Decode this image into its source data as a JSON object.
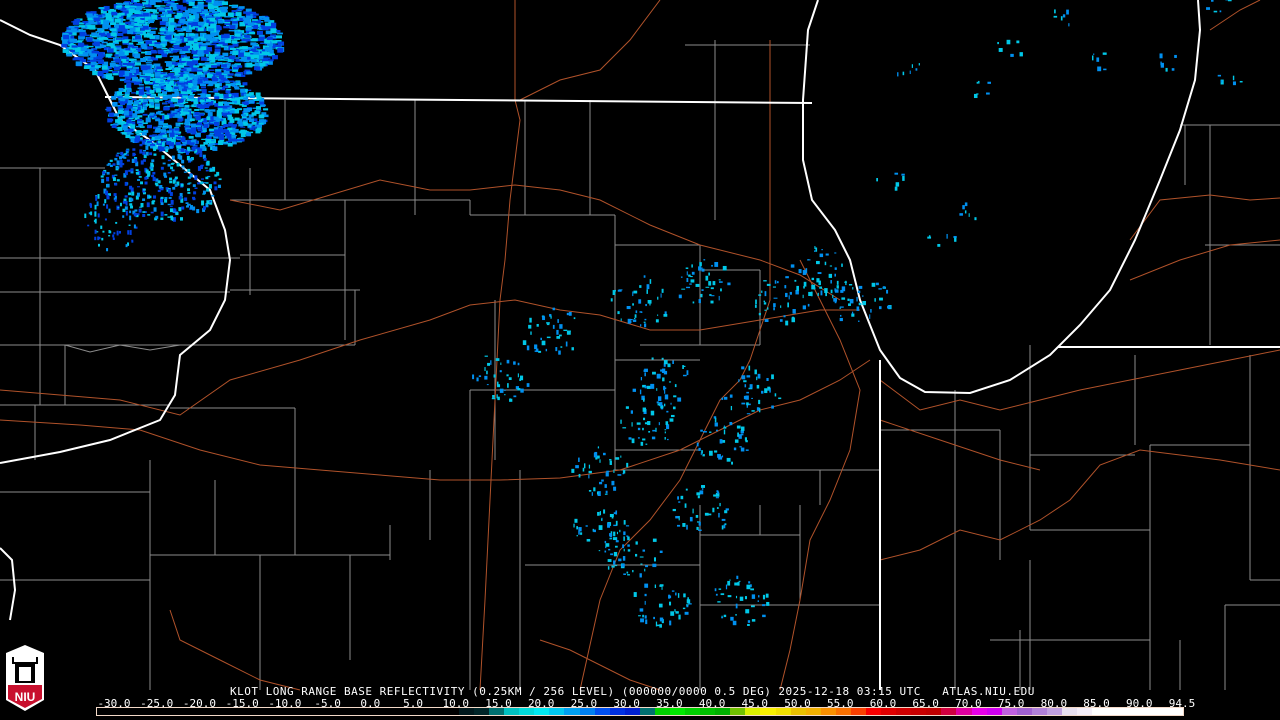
{
  "product": {
    "radar_title": "KLOT LONG RANGE BASE REFLECTIVITY (0.25KM / 256 LEVEL) (000000/0000 0.5 DEG) 2025-12-18 03:15 UTC   ATLAS.NIU.EDU"
  },
  "logo": {
    "text": "NIU"
  },
  "legend": {
    "labels": [
      "-30.0",
      "-25.0",
      "-20.0",
      "-15.0",
      "-10.0",
      "-5.0",
      "0.0",
      "5.0",
      "10.0",
      "15.0",
      "20.0",
      "25.0",
      "30.0",
      "35.0",
      "40.0",
      "45.0",
      "50.0",
      "55.0",
      "60.0",
      "65.0",
      "70.0",
      "75.0",
      "80.0",
      "85.0",
      "90.0",
      "94.5"
    ],
    "colors": [
      "#000000",
      "#000000",
      "#000000",
      "#000000",
      "#000000",
      "#000000",
      "#000000",
      "#000000",
      "#000000",
      "#000000",
      "#000000",
      "#000000",
      "#000000",
      "#000000",
      "#000000",
      "#000000",
      "#000000",
      "#000000",
      "#000000",
      "#000000",
      "#000000",
      "#000000",
      "#000000",
      "#000000",
      "#00181c",
      "#002528",
      "#007070",
      "#00c0c0",
      "#00d8d8",
      "#00e8f0",
      "#00c8f0",
      "#00a0f0",
      "#0080f0",
      "#0050f0",
      "#0030e0",
      "#0020d0",
      "#007070",
      "#00d000",
      "#00e800",
      "#00d000",
      "#00c000",
      "#00b000",
      "#70c000",
      "#d8f000",
      "#f8f000",
      "#f0e000",
      "#e8c000",
      "#f0b000",
      "#f89000",
      "#f87000",
      "#f84000",
      "#f80000",
      "#e00000",
      "#d00000",
      "#c80000",
      "#c00000",
      "#d00040",
      "#e000a0",
      "#e800e8",
      "#d000f0",
      "#c060e0",
      "#a060d0",
      "#b080d8",
      "#c0a0e0",
      "#e8e0f0",
      "#f4eef8",
      "#ffffff",
      "#ffffff",
      "#ffffff",
      "#ffffff",
      "#ffffff",
      "#ffffff"
    ]
  },
  "colors": {
    "state_border": "#ffffff",
    "county_border": "#8c8c8c",
    "highway": "#b0522a",
    "echo_light": "#00c8e8",
    "echo_mid": "#0090f0",
    "echo_dark": "#0040e0"
  }
}
